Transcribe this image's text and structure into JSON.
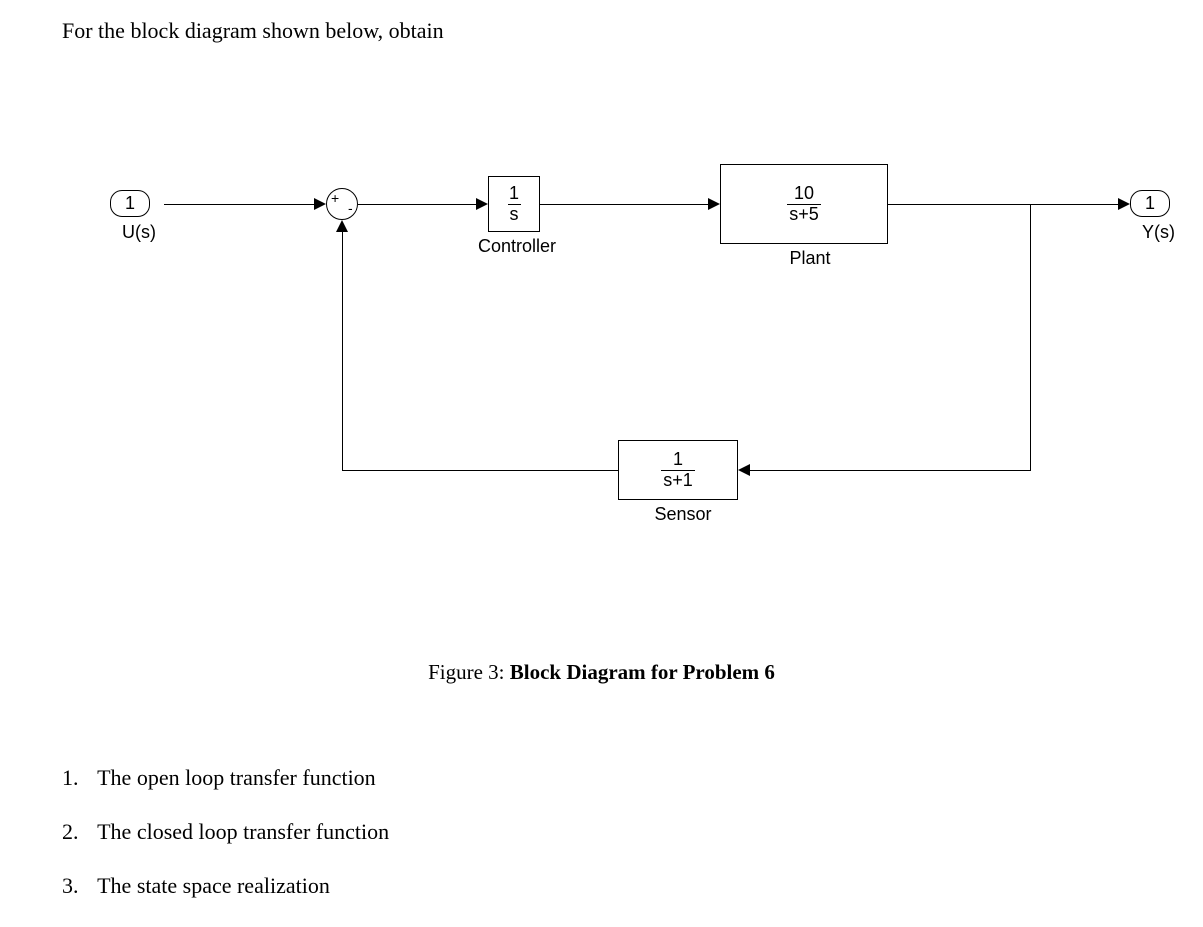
{
  "intro": "For the block diagram shown below, obtain",
  "input": {
    "port": "1",
    "label": "U(s)"
  },
  "output": {
    "port": "1",
    "label": "Y(s)"
  },
  "sum": {
    "plus": "+",
    "minus": "-"
  },
  "controller": {
    "num": "1",
    "den": "s",
    "label": "Controller"
  },
  "plant": {
    "num": "10",
    "den": "s+5",
    "label": "Plant"
  },
  "sensor": {
    "num": "1",
    "den": "s+1",
    "label": "Sensor"
  },
  "caption": {
    "prefix": "Figure 3: ",
    "title": "Block Diagram for Problem 6"
  },
  "questions": [
    {
      "n": "1.",
      "text": "The open loop transfer function"
    },
    {
      "n": "2.",
      "text": "The closed loop transfer function"
    },
    {
      "n": "3.",
      "text": "The state space realization"
    }
  ]
}
